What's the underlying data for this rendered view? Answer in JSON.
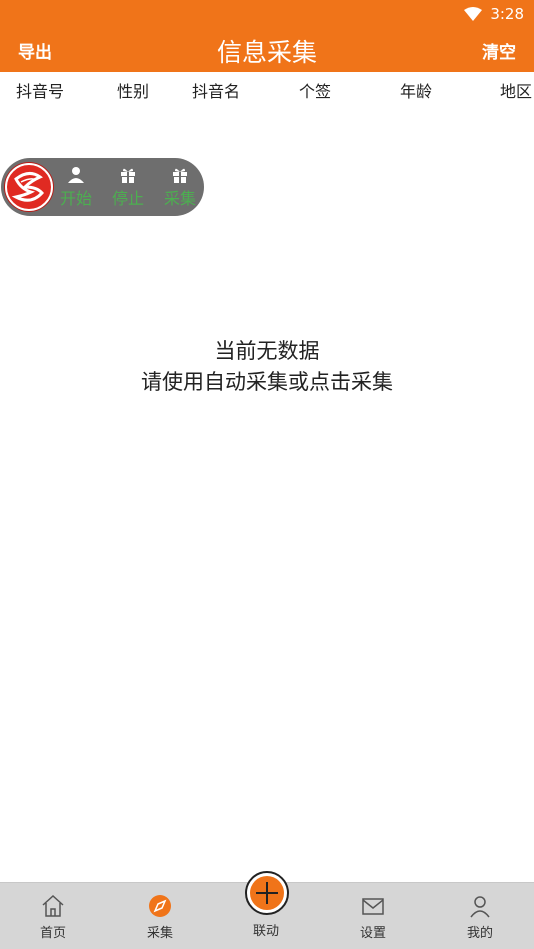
{
  "status_bar": {
    "time": "3:28",
    "icons": [
      "wifi-icon",
      "battery-icon"
    ]
  },
  "app_bar": {
    "left_action": "导出",
    "title": "信息采集",
    "right_action": "清空",
    "background": "#f07419"
  },
  "table_columns": [
    "抖音号",
    "性别",
    "抖音名",
    "个签",
    "年龄",
    "地区"
  ],
  "float_bar": {
    "buttons": [
      {
        "label": "开始",
        "icon": "person-icon"
      },
      {
        "label": "停止",
        "icon": "gift-icon"
      },
      {
        "label": "采集",
        "icon": "gift-icon"
      }
    ],
    "label_color": "#4caf50"
  },
  "empty_state": {
    "line1": "当前无数据",
    "line2": "请使用自动采集或点击采集"
  },
  "bottom_nav": {
    "items": [
      {
        "label": "首页",
        "icon": "home-icon"
      },
      {
        "label": "采集",
        "icon": "compass-icon",
        "active": true
      },
      {
        "label": "联动",
        "icon": "plus-icon"
      },
      {
        "label": "设置",
        "icon": "mail-icon"
      },
      {
        "label": "我的",
        "icon": "user-icon"
      }
    ]
  }
}
